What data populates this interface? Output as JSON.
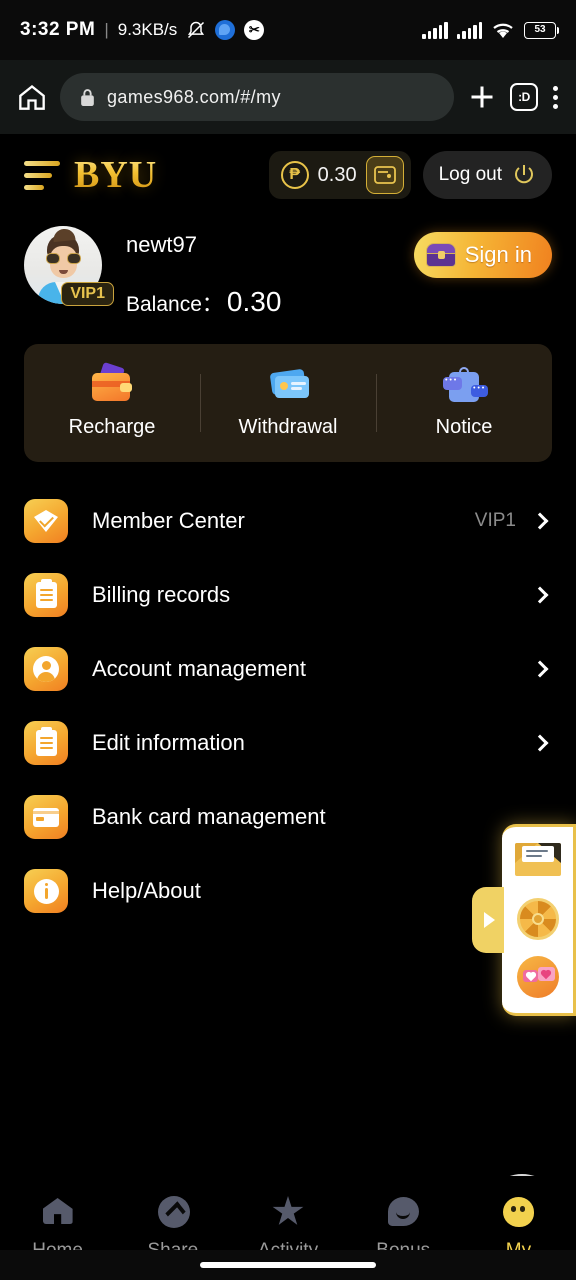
{
  "status_bar": {
    "time": "3:32 PM",
    "divider": "|",
    "network_speed": "9.3KB/s",
    "icons": [
      "mute-icon",
      "messenger-icon",
      "capcut-icon"
    ],
    "signal_1": "signal-bars-icon",
    "signal_2": "signal-bars-icon",
    "wifi": "wifi-icon",
    "battery_percent": "53"
  },
  "browser_bar": {
    "home_icon": "home-icon",
    "lock_icon": "lock-icon",
    "url": "games968.com/#/my",
    "new_tab_icon": "plus-icon",
    "tab_count_label": ":D",
    "menu_icon": "more-vertical-icon"
  },
  "app_header": {
    "menu_icon": "hamburger-icon",
    "logo": "BYU",
    "currency_symbol": "₱",
    "balance": "0.30",
    "wallet_icon": "wallet-icon",
    "logout_label": "Log out",
    "logout_icon": "power-icon"
  },
  "profile": {
    "avatar": "user-avatar",
    "vip_badge": "VIP1",
    "username": "newt97",
    "balance_label": "Balance：",
    "balance_value": "0.30",
    "signin_label": "Sign in",
    "signin_icon": "treasure-chest-icon"
  },
  "quick_actions": [
    {
      "label": "Recharge",
      "icon": "wallet-icon"
    },
    {
      "label": "Withdrawal",
      "icon": "bank-cards-icon"
    },
    {
      "label": "Notice",
      "icon": "notice-clipboard-icon"
    }
  ],
  "menu": [
    {
      "label": "Member Center",
      "icon": "gem-icon",
      "value": "VIP1"
    },
    {
      "label": "Billing records",
      "icon": "document-icon",
      "value": ""
    },
    {
      "label": "Account management",
      "icon": "user-icon",
      "value": ""
    },
    {
      "label": "Edit information",
      "icon": "edit-document-icon",
      "value": ""
    },
    {
      "label": "Bank card management",
      "icon": "credit-card-icon",
      "value": ""
    },
    {
      "label": "Help/About",
      "icon": "info-icon",
      "value": ""
    }
  ],
  "side_panel": {
    "collapse_icon": "arrow-right-icon",
    "items": [
      "mail-icon",
      "lucky-wheel-icon",
      "chat-hearts-icon"
    ]
  },
  "customer_service": {
    "avatar": "support-agent-avatar"
  },
  "bottom_nav": [
    {
      "label": "Home",
      "icon": "home-icon",
      "active": false
    },
    {
      "label": "Share",
      "icon": "share-icon",
      "active": false
    },
    {
      "label": "Activity",
      "icon": "star-icon",
      "active": false
    },
    {
      "label": "Bonus",
      "icon": "chat-bubble-icon",
      "active": false
    },
    {
      "label": "My",
      "icon": "smiley-face-icon",
      "active": true
    }
  ],
  "colors": {
    "background": "#000000",
    "gold": "#f2d14e",
    "gold_gradient_start": "#f6cf53",
    "gold_gradient_end": "#f07f22",
    "card_background": "#251e13",
    "inactive_nav": "#9a9a9a"
  }
}
